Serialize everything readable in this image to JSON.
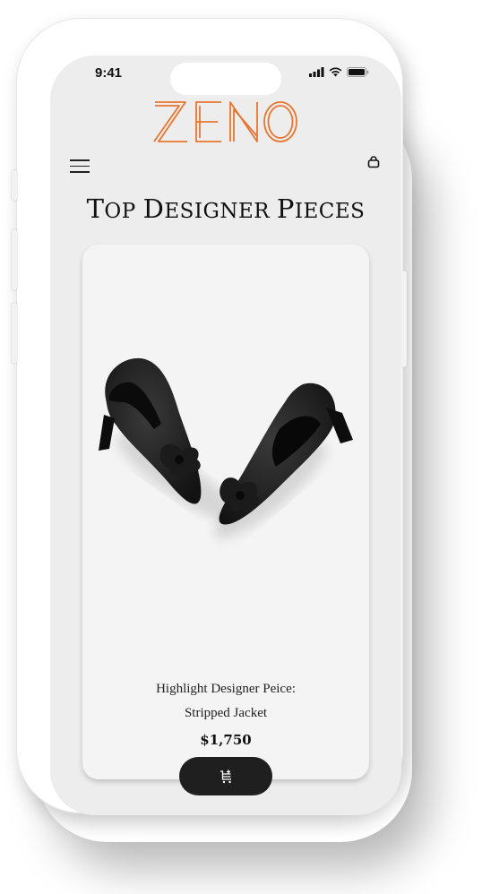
{
  "status_bar": {
    "time": "9:41"
  },
  "brand": {
    "logo_text": "ZENO",
    "accent": "#e8752f"
  },
  "header": {
    "menu_icon": "hamburger-icon",
    "bag_icon": "shopping-bag-icon"
  },
  "page": {
    "title_first": "T",
    "title_rest1": "OP ",
    "title_second": "D",
    "title_rest2": "ESIGNER ",
    "title_third": "P",
    "title_rest3": "IECES"
  },
  "product": {
    "label_line1": "Highlight Designer Peice:",
    "label_line2": "Stripped Jacket",
    "price": "$1,750",
    "cart_icon": "add-to-cart-icon"
  }
}
